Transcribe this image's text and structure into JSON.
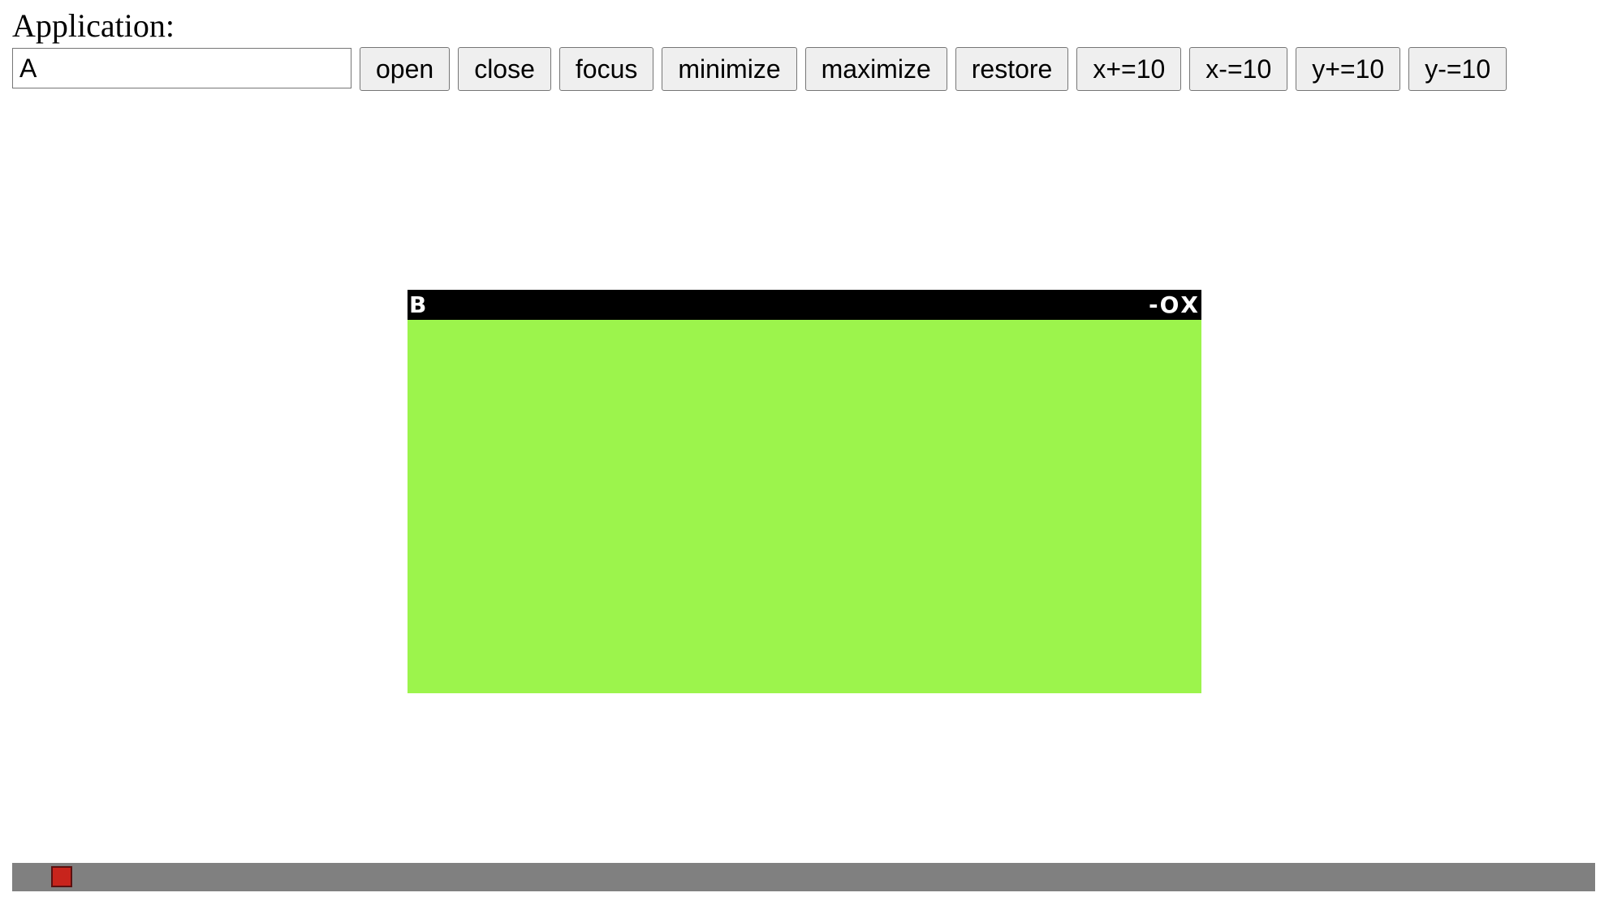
{
  "header": {
    "label": "Application:"
  },
  "controls": {
    "app_input_value": "A",
    "buttons": [
      {
        "label": "open"
      },
      {
        "label": "close"
      },
      {
        "label": "focus"
      },
      {
        "label": "minimize"
      },
      {
        "label": "maximize"
      },
      {
        "label": "restore"
      },
      {
        "label": "x+=10"
      },
      {
        "label": "x-=10"
      },
      {
        "label": "y+=10"
      },
      {
        "label": "y-=10"
      }
    ]
  },
  "window": {
    "title": "B",
    "minimize_glyph": "-",
    "maximize_glyph": "O",
    "close_glyph": "X",
    "body_color": "#9cf44c",
    "titlebar_color": "#000000"
  },
  "taskbar": {
    "color": "#808080",
    "items": [
      {
        "color": "#c8241c"
      }
    ]
  }
}
